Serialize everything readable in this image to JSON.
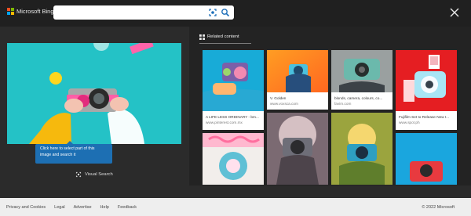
{
  "brand": {
    "name": "Microsoft Bing"
  },
  "search": {
    "value": "",
    "placeholder": ""
  },
  "tabs": {
    "related": "Related content"
  },
  "preview": {
    "tooltip_line1": "Click here to select part of this",
    "tooltip_line2": "image and search it",
    "visual_search": "Visual Search"
  },
  "results": [
    {
      "title": "A LIFE LESS ORDINARY - bm...",
      "source": "www.pinterest.com.mx"
    },
    {
      "title": "V. Golden",
      "source": "www.voxsca.com"
    },
    {
      "title": "blonds, camera, colours, co...",
      "source": "favim.com"
    },
    {
      "title": "Fujifilm Set to Release New I...",
      "source": "www.spot.ph"
    }
  ],
  "footer": {
    "links": [
      "Privacy and Cookies",
      "Legal",
      "Advertise",
      "Help",
      "Feedback"
    ],
    "copyright": "© 2022 Microsoft"
  },
  "colors": {
    "header": "#202020",
    "panel": "#2b2b2b",
    "accent": "#1d6fb3"
  }
}
